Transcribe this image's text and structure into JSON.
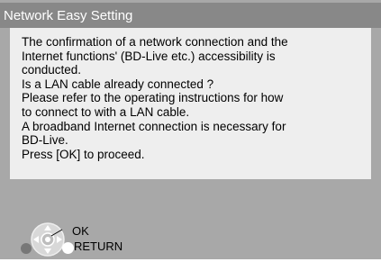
{
  "dialog": {
    "title": "Network Easy Setting",
    "message_lines": [
      "The confirmation of a network connection and the",
      "Internet functions' (BD-Live etc.) accessibility is",
      "conducted.",
      "Is a LAN cable already connected ?",
      "Please refer to the operating instructions for how",
      "to connect to with a LAN cable.",
      "A broadband Internet connection is necessary for",
      "BD-Live.",
      "Press [OK] to proceed."
    ]
  },
  "controls": {
    "ok_label": "OK",
    "return_label": "RETURN",
    "icons": [
      "dpad-icon",
      "return-button-icon"
    ]
  },
  "colors": {
    "background": "#a8a8a8",
    "title_bar": "#888888",
    "message_box": "#eeeeee",
    "text": "#000000"
  }
}
